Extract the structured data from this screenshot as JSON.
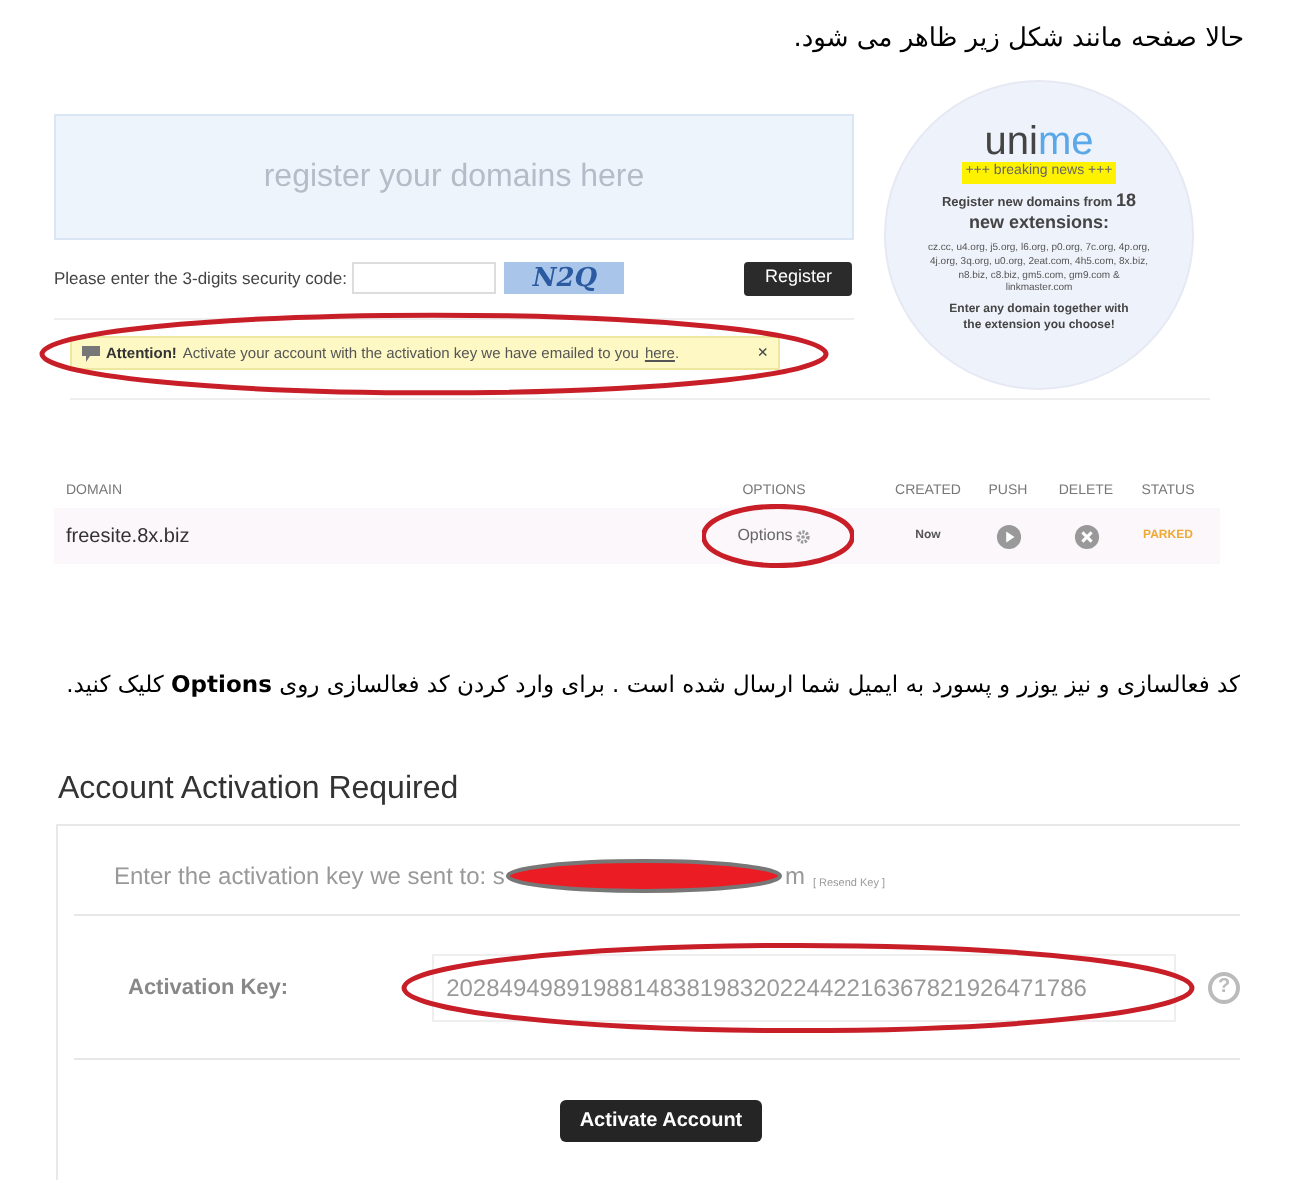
{
  "intro_text": "حالا صفحه مانند شکل زیر ظاهر می شود.",
  "register_page": {
    "banner": "register your domains here",
    "security_label": "Please enter the 3-digits security code:",
    "captcha": "N2Q",
    "register_button": "Register",
    "alert": {
      "title": "Attention!",
      "message": "Activate your account with the activation key we have emailed to you",
      "link": "here",
      "end": ".",
      "close": "×",
      "highlighted": true
    },
    "promo": {
      "logo_a": "uni",
      "logo_b": "me",
      "tag": "+++ breaking news +++",
      "headline_a": "Register new domains from",
      "headline_num": "18",
      "headline_b": "new extensions:",
      "extensions": "cz.cc, u4.org, j5.org, l6.org, p0.org, 7c.org, 4p.org, 4j.org, 3q.org, u0.org, 2eat.com, 4h5.com, 8x.biz, n8.biz, c8.biz, gm5.com, gm9.com & linkmaster.com",
      "footer": "Enter any domain together with the extension you choose!"
    }
  },
  "domains_table": {
    "columns": [
      "DOMAIN",
      "OPTIONS",
      "CREATED",
      "PUSH",
      "DELETE",
      "STATUS"
    ],
    "rows": [
      {
        "domain": "freesite.8x.biz",
        "options": "Options",
        "options_highlighted": true,
        "created": "Now",
        "status": "PARKED"
      }
    ]
  },
  "instruction_text": "کد فعالسازی و نیز یوزر و پسورد به ایمیل شما ارسال شده است . برای وارد کردن کد فعالسازی روی **Options** کلیک کنید.",
  "activation": {
    "title": "Account Activation Required",
    "sent_prefix": "Enter the activation key we sent to: s",
    "sent_suffix": "m",
    "email_redacted": true,
    "resend": "[ Resend Key ]",
    "key_label": "Activation Key:",
    "key_value": "202849498919881483819832022442216367821926471786",
    "key_highlighted": true,
    "help": "?",
    "button": "Activate Account"
  }
}
